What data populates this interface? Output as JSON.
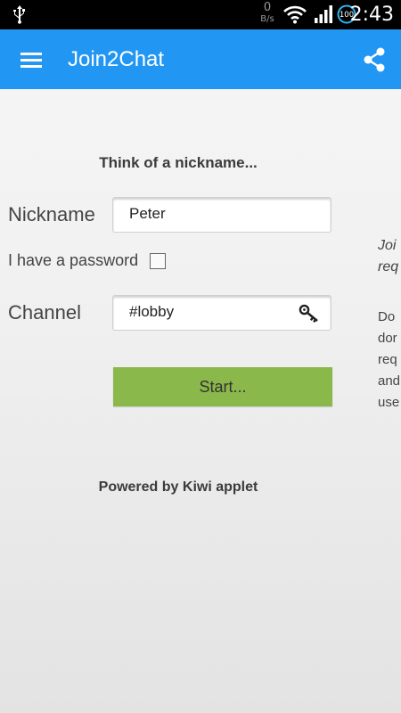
{
  "status_bar": {
    "net_speed_value": "0",
    "net_speed_unit": "B/s",
    "battery_level": "100",
    "time": "2:43"
  },
  "app_bar": {
    "title": "Join2Chat",
    "menu_icon": "hamburger-menu-icon",
    "share_icon": "share-icon",
    "color": "#2196f3"
  },
  "form": {
    "prompt": "Think of a nickname...",
    "nickname_label": "Nickname",
    "nickname_value": "Peter",
    "password_label": "I have a password",
    "password_checked": false,
    "channel_label": "Channel",
    "channel_value": "#lobby",
    "channel_key_icon": "key-icon",
    "start_label": "Start...",
    "start_color": "#8bb84a"
  },
  "footer": {
    "powered_by": "Powered by Kiwi applet"
  },
  "side_panel": {
    "title_lines": [
      "Joi",
      "req"
    ],
    "body_lines": [
      "Do",
      "dor",
      "req",
      "and",
      "use"
    ]
  }
}
